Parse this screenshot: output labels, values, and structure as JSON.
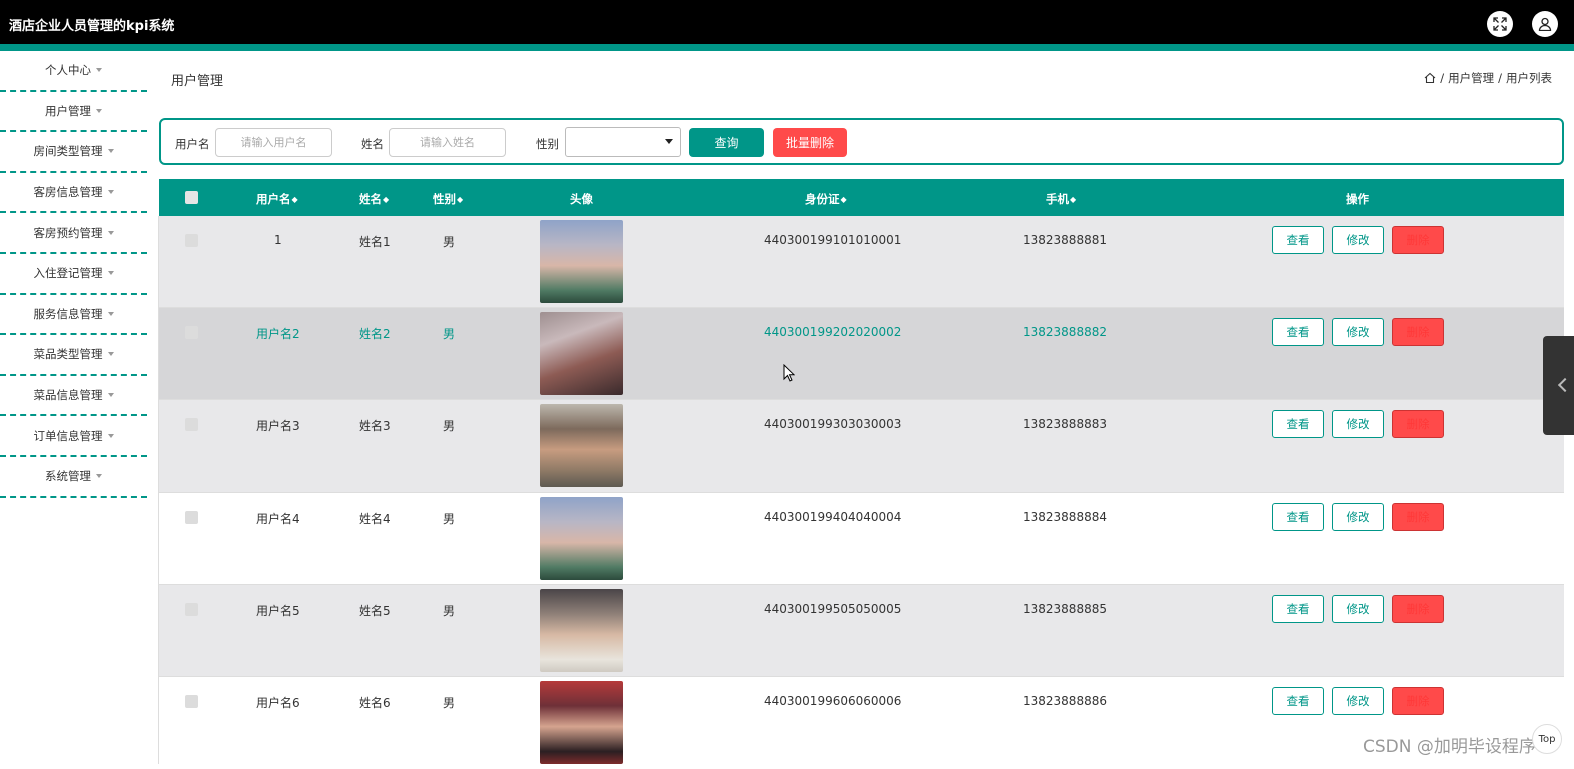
{
  "app": {
    "title": "酒店企业人员管理的kpi系统"
  },
  "colors": {
    "accent": "#009688",
    "danger": "#ff4a4a",
    "topbar": "#000000"
  },
  "header_icons": [
    "fullscreen-icon",
    "user-icon"
  ],
  "sidebar": {
    "items": [
      {
        "label": "个人中心"
      },
      {
        "label": "用户管理"
      },
      {
        "label": "房间类型管理"
      },
      {
        "label": "客房信息管理"
      },
      {
        "label": "客房预约管理"
      },
      {
        "label": "入住登记管理"
      },
      {
        "label": "服务信息管理"
      },
      {
        "label": "菜品类型管理"
      },
      {
        "label": "菜品信息管理"
      },
      {
        "label": "订单信息管理"
      },
      {
        "label": "系统管理"
      }
    ]
  },
  "page": {
    "title": "用户管理",
    "breadcrumb": {
      "sep": "/",
      "level1": "用户管理",
      "level2": "用户列表"
    }
  },
  "search": {
    "username_label": "用户名",
    "username_placeholder": "请输入用户名",
    "name_label": "姓名",
    "name_placeholder": "请输入姓名",
    "gender_label": "性别",
    "gender_value": "",
    "query_button": "查询",
    "bulk_delete_button": "批量删除"
  },
  "table": {
    "headers": {
      "username": "用户名",
      "name": "姓名",
      "gender": "性别",
      "avatar": "头像",
      "idcard": "身份证",
      "phone": "手机",
      "actions": "操作"
    },
    "action_labels": {
      "view": "查看",
      "edit": "修改",
      "delete": "删除"
    },
    "rows": [
      {
        "username": "1",
        "name": "姓名1",
        "gender": "男",
        "idcard": "440300199101010001",
        "phone": "13823888881"
      },
      {
        "username": "用户名2",
        "name": "姓名2",
        "gender": "男",
        "idcard": "440300199202020002",
        "phone": "13823888882"
      },
      {
        "username": "用户名3",
        "name": "姓名3",
        "gender": "男",
        "idcard": "440300199303030003",
        "phone": "13823888883"
      },
      {
        "username": "用户名4",
        "name": "姓名4",
        "gender": "男",
        "idcard": "440300199404040004",
        "phone": "13823888884"
      },
      {
        "username": "用户名5",
        "name": "姓名5",
        "gender": "男",
        "idcard": "440300199505050005",
        "phone": "13823888885"
      },
      {
        "username": "用户名6",
        "name": "姓名6",
        "gender": "男",
        "idcard": "440300199606060006",
        "phone": "13823888886"
      }
    ]
  },
  "watermark": "CSDN @加明毕设程序",
  "back_to_top": "Top"
}
